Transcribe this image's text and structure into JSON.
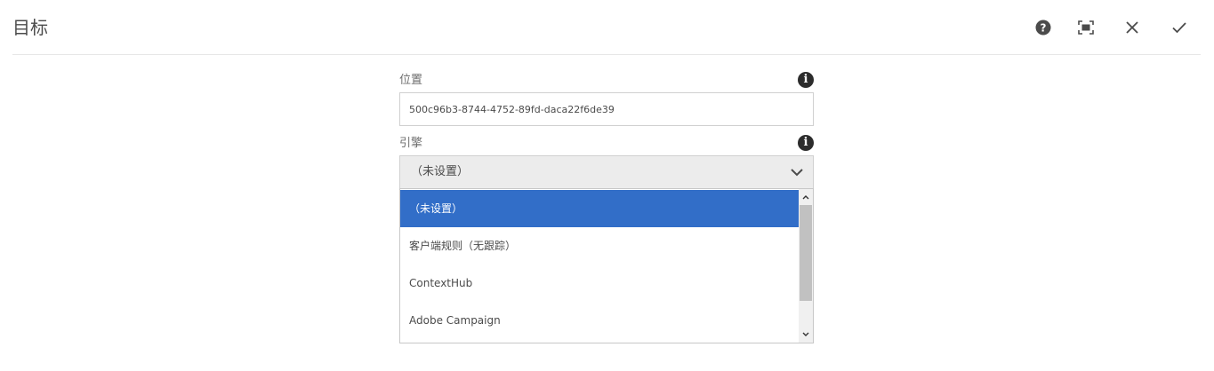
{
  "header": {
    "title": "目标",
    "actions": [
      {
        "name": "help-button",
        "icon": "help-icon"
      },
      {
        "name": "fullscreen-button",
        "icon": "fullscreen-icon"
      },
      {
        "name": "close-button",
        "icon": "close-icon"
      },
      {
        "name": "done-button",
        "icon": "check-icon"
      }
    ]
  },
  "form": {
    "location": {
      "label": "位置",
      "value": "500c96b3-8744-4752-89fd-daca22f6de39",
      "info_icon": "info-icon"
    },
    "engine": {
      "label": "引擎",
      "selected": "（未设置）",
      "info_icon": "info-icon",
      "options": [
        {
          "label": "（未设置）",
          "selected": true
        },
        {
          "label": "客户端规则（无跟踪）",
          "selected": false
        },
        {
          "label": "ContextHub",
          "selected": false
        },
        {
          "label": "Adobe Campaign",
          "selected": false
        }
      ]
    }
  },
  "colors": {
    "selected_option_bg": "#326ec8",
    "select_bg": "#ececec"
  }
}
